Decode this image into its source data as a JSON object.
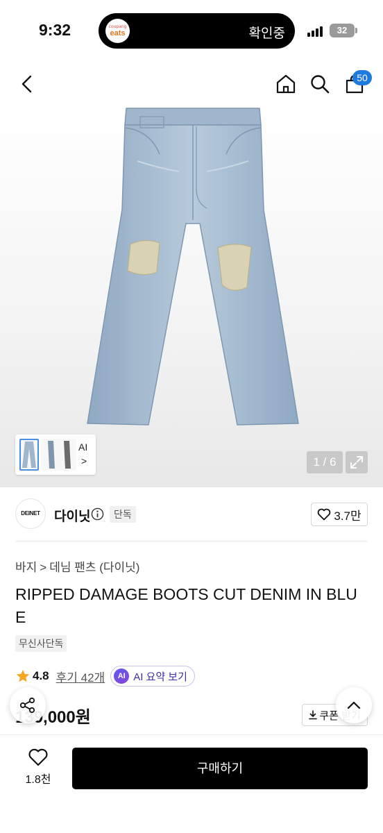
{
  "status_bar": {
    "time": "9:32",
    "island_app_small": "coupang",
    "island_app": "eats",
    "island_text": "확인중",
    "battery": "32"
  },
  "header": {
    "cart_count": "50",
    "icons": [
      "chevron-left-icon",
      "home-icon",
      "search-icon",
      "cart-icon"
    ]
  },
  "gallery": {
    "thumbnail_label": "AI",
    "thumbnail_chevron": ">",
    "page_indicator": "1 / 6"
  },
  "brand": {
    "logo_text": "DEINET",
    "name": "다이닛",
    "badge": "단독",
    "likes": "3.7만"
  },
  "product": {
    "breadcrumb": [
      "바지",
      "데님 팬츠 (다이닛)"
    ],
    "breadcrumb_separator": ">",
    "title": "RIPPED DAMAGE BOOTS CUT DENIM IN BLUE",
    "tag": "무신사단독",
    "rating": "4.8",
    "reviews": "후기 42개",
    "ai_badge": "AI",
    "ai_summary": "AI 요약 보기",
    "price": "139,000원",
    "coupon_label": "쿠폰 받기"
  },
  "bottom_bar": {
    "wish_count": "1.8천",
    "buy_label": "구매하기"
  },
  "colors": {
    "accent_blue": "#1f7ae0",
    "denim": "#a9bfd3",
    "star": "#f5a623",
    "ai_purple": "#6a4fe0",
    "buy_button": "#000000"
  }
}
